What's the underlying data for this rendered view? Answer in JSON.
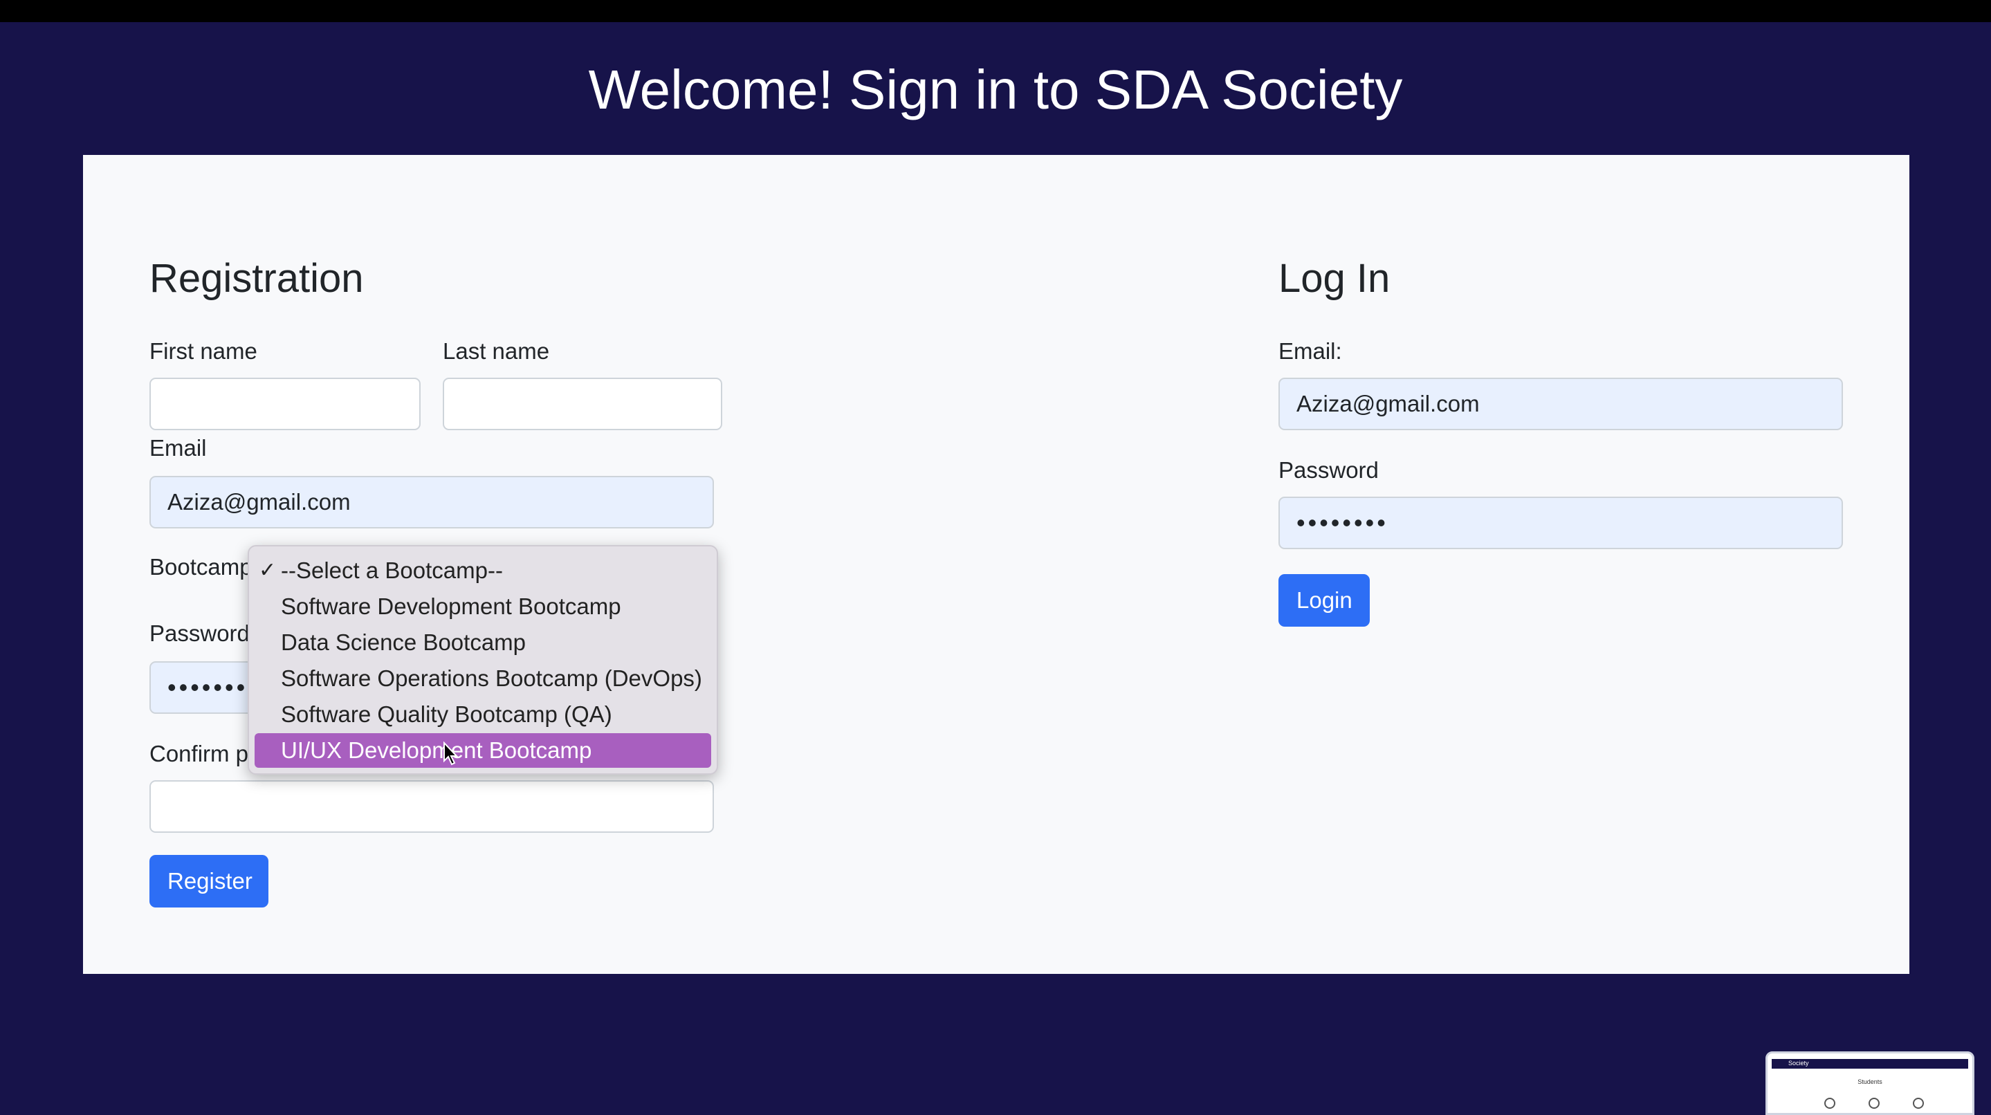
{
  "header": {
    "title": "Welcome! Sign in to SDA Society"
  },
  "registration": {
    "title": "Registration",
    "first_name_label": "First name",
    "first_name_value": "",
    "last_name_label": "Last name",
    "last_name_value": "",
    "email_label": "Email",
    "email_value": "Aziza@gmail.com",
    "bootcamp_label": "Bootcamp",
    "password_label": "Password",
    "password_value": "••••••••",
    "confirm_label": "Confirm password",
    "confirm_value": "",
    "register_label": "Register"
  },
  "bootcamp_dropdown": {
    "selected_index": 0,
    "highlighted_index": 5,
    "check_mark": "✓",
    "options": [
      "--Select a Bootcamp--",
      "Software Development Bootcamp",
      "Data Science Bootcamp",
      "Software Operations Bootcamp (DevOps)",
      "Software Quality Bootcamp (QA)",
      "UI/UX Development Bootcamp"
    ]
  },
  "login": {
    "title": "Log In",
    "email_label": "Email:",
    "email_value": "Aziza@gmail.com",
    "password_label": "Password",
    "password_value": "••••••••",
    "login_label": "Login"
  },
  "thumbnail": {
    "app_name": "Society",
    "page_title": "Students"
  },
  "colors": {
    "background": "#17134a",
    "panel": "#f8f9fb",
    "primary_button": "#2d6ef5",
    "autofill": "#e8f0fe",
    "dropdown_highlight": "#a85fbf"
  }
}
